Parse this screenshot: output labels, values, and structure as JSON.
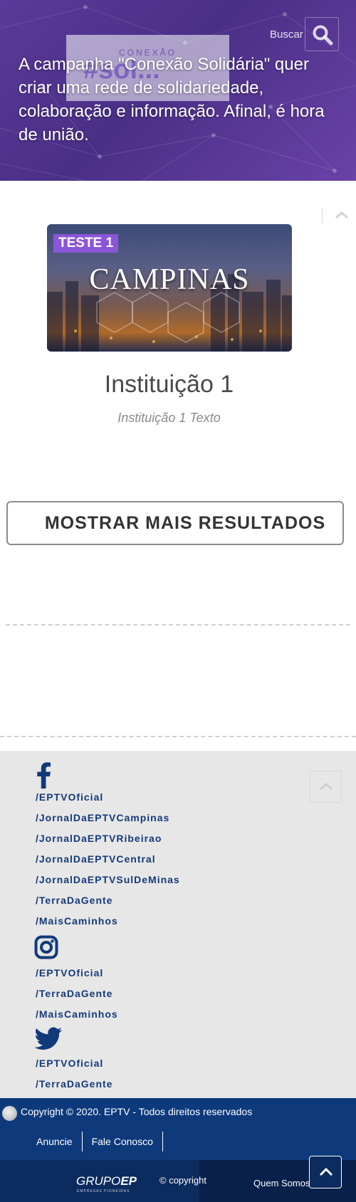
{
  "hero": {
    "logo_small": "CONEXÃO",
    "logo_tag": "#sol...",
    "search_label": "Buscar",
    "search_icon": "magnifier-icon",
    "text": "A campanha \"Conexão Solidária\" quer criar uma rede de solidariedade, colaboração e informação. Afinal, é hora de união."
  },
  "card": {
    "badge": "TESTE 1",
    "city": "CAMPINAS",
    "title": "Instituição 1",
    "subtitle": "Instituição 1 Texto"
  },
  "more_button": "MOSTRAR MAIS RESULTADOS",
  "social": {
    "facebook": [
      "/EPTVOficial",
      "/JornalDaEPTVCampinas",
      "/JornalDaEPTVRibeirao",
      "/JornalDaEPTVCentral",
      "/JornalDaEPTVSulDeMinas",
      "/TerraDaGente",
      "/MaisCaminhos"
    ],
    "instagram": [
      "/EPTVOficial",
      "/TerraDaGente",
      "/MaisCaminhos"
    ],
    "twitter": [
      "/EPTVOficial",
      "/TerraDaGente"
    ]
  },
  "footer": {
    "copyright": "Copyright © 2020. EPTV - Todos direitos reservados",
    "links": [
      "Anuncie",
      "Fale Conosco"
    ],
    "grupo_a": "GRUPO",
    "grupo_b": "EP",
    "grupo_sub": "EMPRESAS PIONEIRAS",
    "copyright_link": "© copyright",
    "quem_somos": "Quem Somos"
  },
  "colors": {
    "hero": "#5a3a9a",
    "link": "#123a7a",
    "footer": "#0e3a7c",
    "bottom": "#0c2b5e"
  }
}
